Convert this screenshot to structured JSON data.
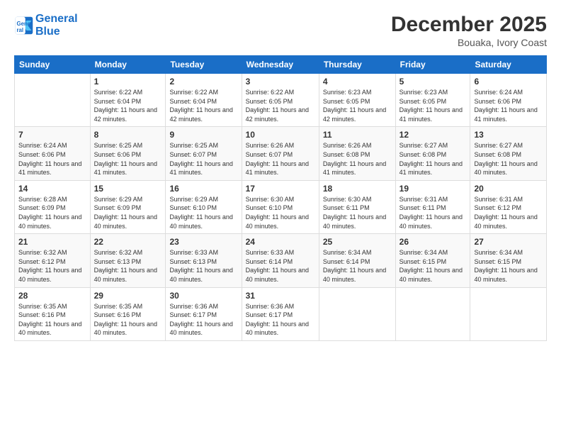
{
  "header": {
    "logo_line1": "General",
    "logo_line2": "Blue",
    "month": "December 2025",
    "location": "Bouaka, Ivory Coast"
  },
  "weekdays": [
    "Sunday",
    "Monday",
    "Tuesday",
    "Wednesday",
    "Thursday",
    "Friday",
    "Saturday"
  ],
  "weeks": [
    [
      {
        "num": "",
        "sunrise": "",
        "sunset": "",
        "daylight": "",
        "empty": true
      },
      {
        "num": "1",
        "sunrise": "6:22 AM",
        "sunset": "6:04 PM",
        "daylight": "11 hours and 42 minutes."
      },
      {
        "num": "2",
        "sunrise": "6:22 AM",
        "sunset": "6:04 PM",
        "daylight": "11 hours and 42 minutes."
      },
      {
        "num": "3",
        "sunrise": "6:22 AM",
        "sunset": "6:05 PM",
        "daylight": "11 hours and 42 minutes."
      },
      {
        "num": "4",
        "sunrise": "6:23 AM",
        "sunset": "6:05 PM",
        "daylight": "11 hours and 42 minutes."
      },
      {
        "num": "5",
        "sunrise": "6:23 AM",
        "sunset": "6:05 PM",
        "daylight": "11 hours and 41 minutes."
      },
      {
        "num": "6",
        "sunrise": "6:24 AM",
        "sunset": "6:06 PM",
        "daylight": "11 hours and 41 minutes."
      }
    ],
    [
      {
        "num": "7",
        "sunrise": "6:24 AM",
        "sunset": "6:06 PM",
        "daylight": "11 hours and 41 minutes."
      },
      {
        "num": "8",
        "sunrise": "6:25 AM",
        "sunset": "6:06 PM",
        "daylight": "11 hours and 41 minutes."
      },
      {
        "num": "9",
        "sunrise": "6:25 AM",
        "sunset": "6:07 PM",
        "daylight": "11 hours and 41 minutes."
      },
      {
        "num": "10",
        "sunrise": "6:26 AM",
        "sunset": "6:07 PM",
        "daylight": "11 hours and 41 minutes."
      },
      {
        "num": "11",
        "sunrise": "6:26 AM",
        "sunset": "6:08 PM",
        "daylight": "11 hours and 41 minutes."
      },
      {
        "num": "12",
        "sunrise": "6:27 AM",
        "sunset": "6:08 PM",
        "daylight": "11 hours and 41 minutes."
      },
      {
        "num": "13",
        "sunrise": "6:27 AM",
        "sunset": "6:08 PM",
        "daylight": "11 hours and 40 minutes."
      }
    ],
    [
      {
        "num": "14",
        "sunrise": "6:28 AM",
        "sunset": "6:09 PM",
        "daylight": "11 hours and 40 minutes."
      },
      {
        "num": "15",
        "sunrise": "6:29 AM",
        "sunset": "6:09 PM",
        "daylight": "11 hours and 40 minutes."
      },
      {
        "num": "16",
        "sunrise": "6:29 AM",
        "sunset": "6:10 PM",
        "daylight": "11 hours and 40 minutes."
      },
      {
        "num": "17",
        "sunrise": "6:30 AM",
        "sunset": "6:10 PM",
        "daylight": "11 hours and 40 minutes."
      },
      {
        "num": "18",
        "sunrise": "6:30 AM",
        "sunset": "6:11 PM",
        "daylight": "11 hours and 40 minutes."
      },
      {
        "num": "19",
        "sunrise": "6:31 AM",
        "sunset": "6:11 PM",
        "daylight": "11 hours and 40 minutes."
      },
      {
        "num": "20",
        "sunrise": "6:31 AM",
        "sunset": "6:12 PM",
        "daylight": "11 hours and 40 minutes."
      }
    ],
    [
      {
        "num": "21",
        "sunrise": "6:32 AM",
        "sunset": "6:12 PM",
        "daylight": "11 hours and 40 minutes."
      },
      {
        "num": "22",
        "sunrise": "6:32 AM",
        "sunset": "6:13 PM",
        "daylight": "11 hours and 40 minutes."
      },
      {
        "num": "23",
        "sunrise": "6:33 AM",
        "sunset": "6:13 PM",
        "daylight": "11 hours and 40 minutes."
      },
      {
        "num": "24",
        "sunrise": "6:33 AM",
        "sunset": "6:14 PM",
        "daylight": "11 hours and 40 minutes."
      },
      {
        "num": "25",
        "sunrise": "6:34 AM",
        "sunset": "6:14 PM",
        "daylight": "11 hours and 40 minutes."
      },
      {
        "num": "26",
        "sunrise": "6:34 AM",
        "sunset": "6:15 PM",
        "daylight": "11 hours and 40 minutes."
      },
      {
        "num": "27",
        "sunrise": "6:34 AM",
        "sunset": "6:15 PM",
        "daylight": "11 hours and 40 minutes."
      }
    ],
    [
      {
        "num": "28",
        "sunrise": "6:35 AM",
        "sunset": "6:16 PM",
        "daylight": "11 hours and 40 minutes."
      },
      {
        "num": "29",
        "sunrise": "6:35 AM",
        "sunset": "6:16 PM",
        "daylight": "11 hours and 40 minutes."
      },
      {
        "num": "30",
        "sunrise": "6:36 AM",
        "sunset": "6:17 PM",
        "daylight": "11 hours and 40 minutes."
      },
      {
        "num": "31",
        "sunrise": "6:36 AM",
        "sunset": "6:17 PM",
        "daylight": "11 hours and 40 minutes."
      },
      {
        "num": "",
        "sunrise": "",
        "sunset": "",
        "daylight": "",
        "empty": true
      },
      {
        "num": "",
        "sunrise": "",
        "sunset": "",
        "daylight": "",
        "empty": true
      },
      {
        "num": "",
        "sunrise": "",
        "sunset": "",
        "daylight": "",
        "empty": true
      }
    ]
  ]
}
